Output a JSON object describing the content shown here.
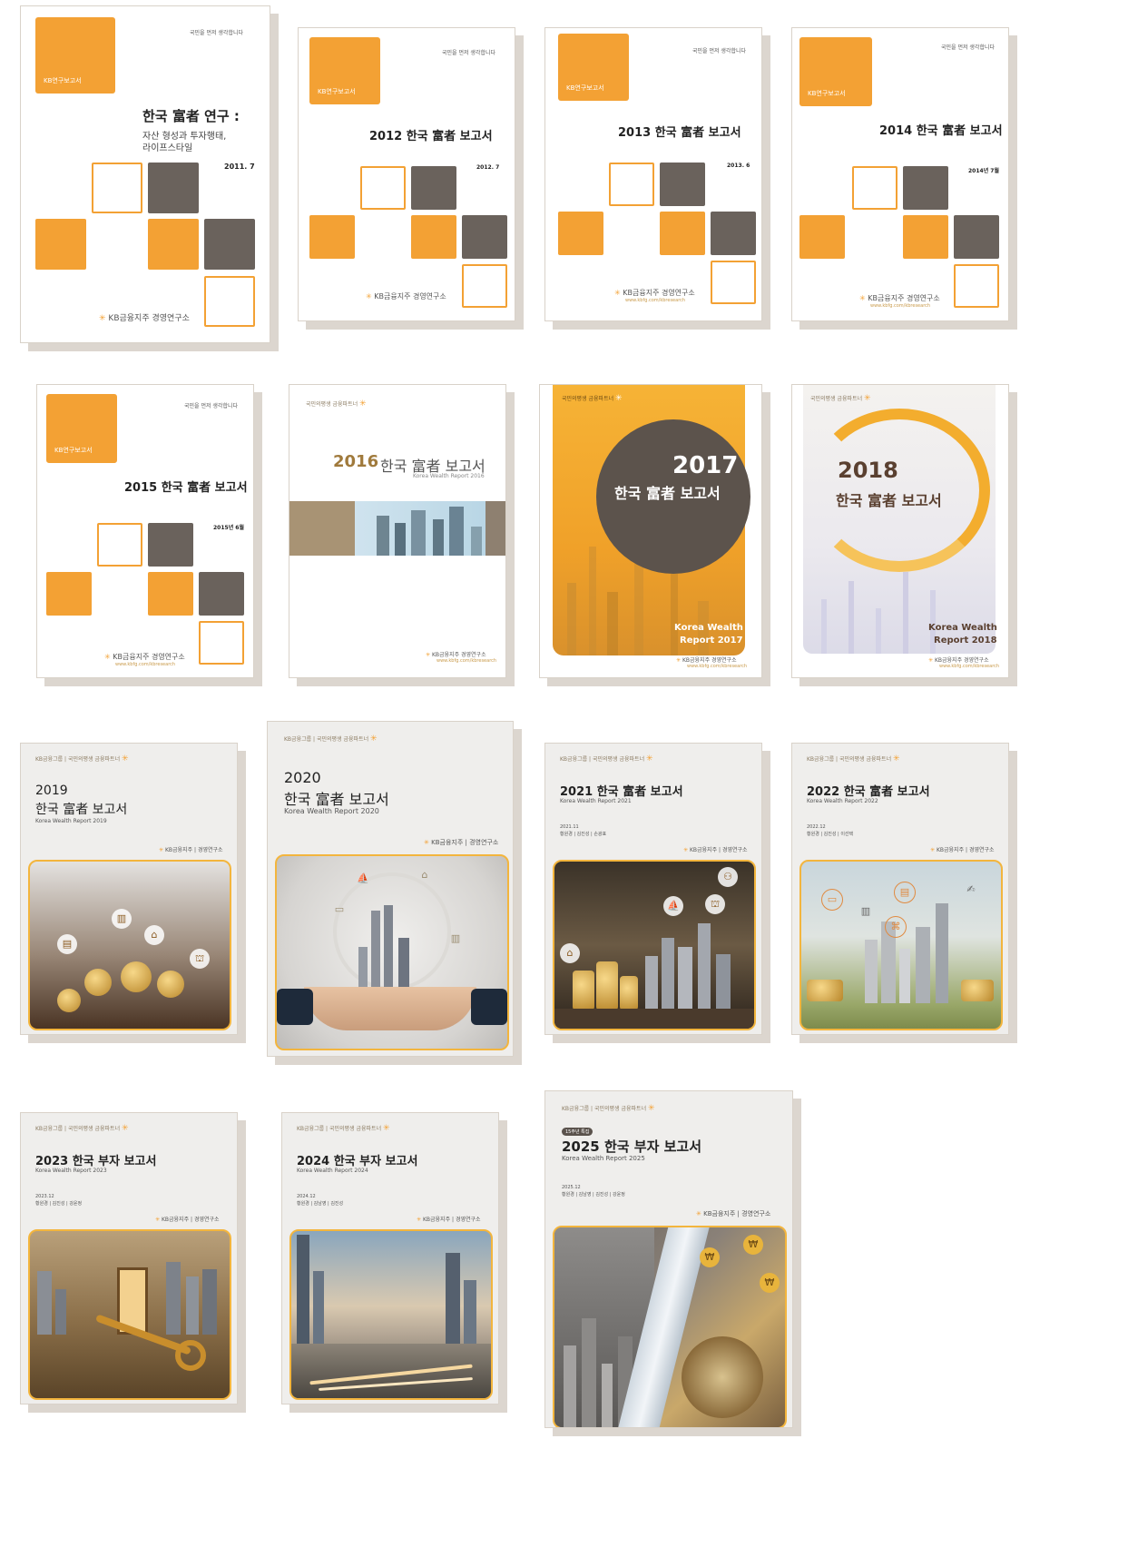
{
  "colors": {
    "orange": "#f3a134",
    "dark": "#6a625c",
    "gold": "#f3b53d"
  },
  "common": {
    "tagline": "국민을 먼저 생각합니다",
    "kb_report": "KB연구보고서",
    "kb_institute": "KB금융지주 경영연구소",
    "kb_url": "www.kbfg.com/kbresearch",
    "kb_group": "KB금융그룹",
    "kb_slogan": "국민의평생 금융파트너",
    "kb_holding": "KB금융지주",
    "kb_research": "경영연구소"
  },
  "covers": {
    "c2011": {
      "title": "한국 富者 연구 :",
      "subtitle1": "자산 형성과 투자행태,",
      "subtitle2": "라이프스타일",
      "date": "2011. 7"
    },
    "c2012": {
      "title": "2012 한국 富者 보고서",
      "date": "2012. 7"
    },
    "c2013": {
      "title": "2013 한국 富者 보고서",
      "date": "2013. 6"
    },
    "c2014": {
      "title": "2014 한국 富者 보고서",
      "date": "2014년 7월"
    },
    "c2015": {
      "title": "2015 한국 富者 보고서",
      "date": "2015년 6월"
    },
    "c2016": {
      "year": "2016",
      "title": "한국 富者 보고서",
      "subtitle": "Korea Wealth Report 2016"
    },
    "c2017": {
      "year": "2017",
      "title": "한국 富者 보고서",
      "english1": "Korea Wealth",
      "english2": "Report 2017"
    },
    "c2018": {
      "year": "2018",
      "title": "한국 富者 보고서",
      "english1": "Korea Wealth",
      "english2": "Report 2018"
    },
    "c2019": {
      "year": "2019",
      "title": "한국 富者 보고서",
      "subtitle": "Korea Wealth Report 2019"
    },
    "c2020": {
      "year": "2020",
      "title": "한국 富者 보고서",
      "subtitle": "Korea Wealth Report 2020"
    },
    "c2021": {
      "title": "2021 한국 富者 보고서",
      "subtitle": "Korea Wealth Report 2021",
      "date": "2021.11",
      "authors": "황원경 | 김진성 | 손광표"
    },
    "c2022": {
      "title": "2022 한국 富者 보고서",
      "subtitle": "Korea Wealth Report 2022",
      "date": "2022.12",
      "authors": "황원경 | 김진성 | 이선택"
    },
    "c2023": {
      "title": "2023 한국 부자 보고서",
      "subtitle": "Korea Wealth Report 2023",
      "date": "2023.12",
      "authors": "황원경 | 김진성 | 강윤정"
    },
    "c2024": {
      "title": "2024 한국 부자 보고서",
      "subtitle": "Korea Wealth Report 2024",
      "date": "2024.12",
      "authors": "황원경 | 김남영 | 김진성"
    },
    "c2025": {
      "badge": "15주년 특집",
      "title": "2025 한국 부자 보고서",
      "subtitle": "Korea Wealth Report 2025",
      "date": "2025.12",
      "authors": "황원경 | 김남영 | 김진성 | 강윤정"
    }
  }
}
